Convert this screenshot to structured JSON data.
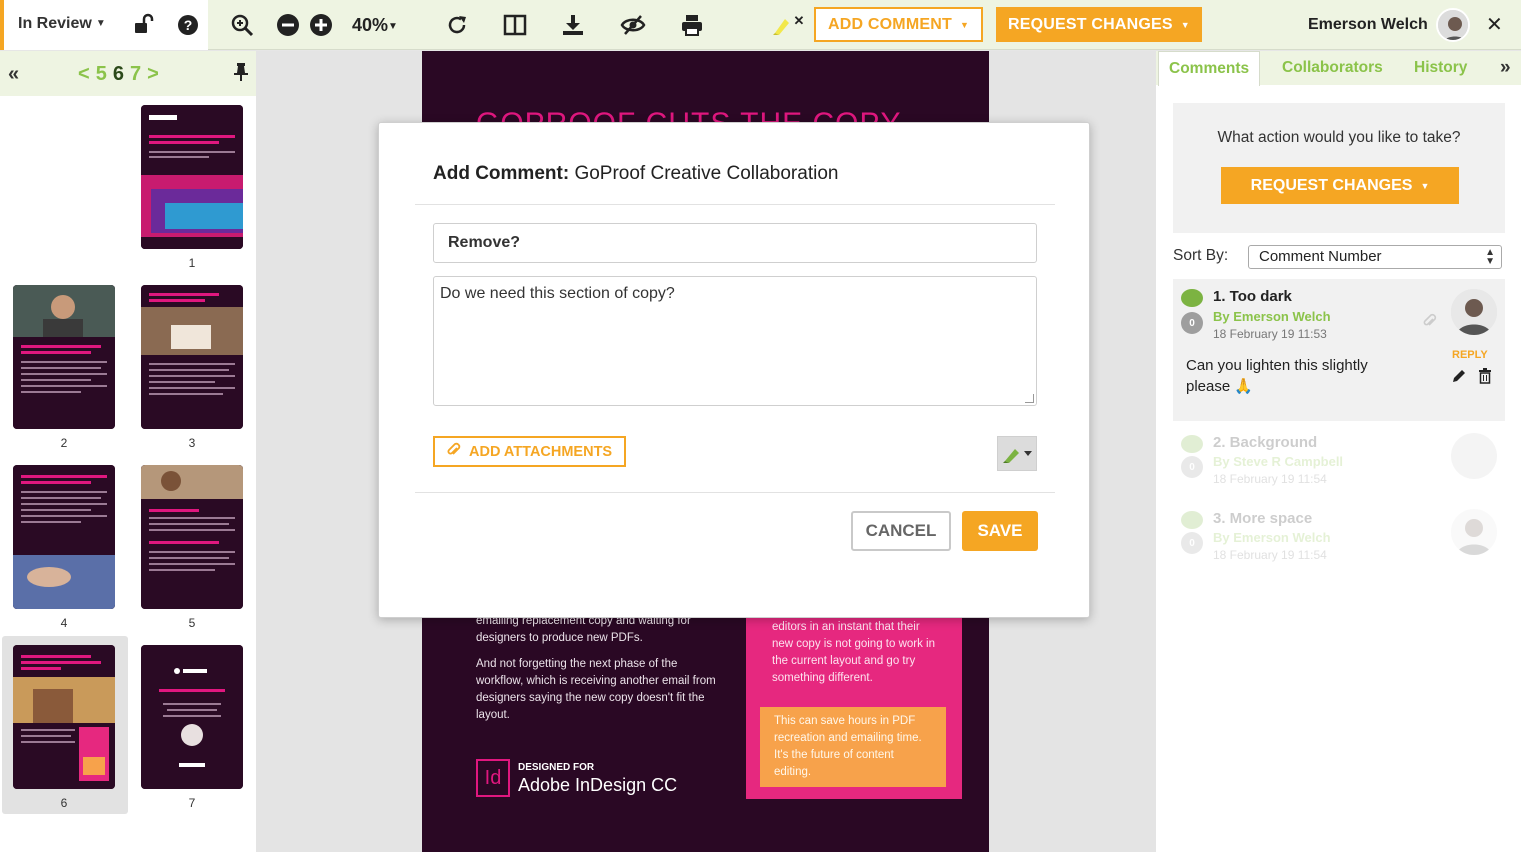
{
  "toolbar": {
    "status": "In Review",
    "zoom": "40%",
    "add_comment": "ADD COMMENT",
    "request_changes": "REQUEST CHANGES",
    "user_name": "Emerson Welch"
  },
  "left_panel": {
    "pages_prev": "<",
    "pages_nums": [
      "5",
      "6",
      "7"
    ],
    "pages_next": ">",
    "thumbnails": [
      "1",
      "2",
      "3",
      "4",
      "5",
      "6",
      "7"
    ]
  },
  "document": {
    "heading": "GOPROOF CUTS THE COPY",
    "para1": "emailing replacement copy and waiting for designers to produce new PDFs.",
    "para2": "And not forgetting the next phase of the workflow, which is receiving another email from designers saying the new copy doesn't fit the layout.",
    "pink_text": "editors in an instant that their new copy is not going to work in the current layout and go try something different.",
    "orange_text": "This can save hours in PDF recreation and emailing time. It's the future of content editing.",
    "logo_letters": "Id",
    "designed_for": "DESIGNED FOR",
    "product": "Adobe InDesign CC"
  },
  "modal": {
    "title_bold": "Add Comment:",
    "title_rest": "GoProof Creative Collaboration",
    "subject_value": "Remove?",
    "body_value": "Do we need this section of copy?",
    "attach_label": "ADD ATTACHMENTS",
    "cancel_label": "CANCEL",
    "save_label": "SAVE"
  },
  "right_panel": {
    "tabs": [
      "Comments",
      "Collaborators",
      "History"
    ],
    "action_question": "What action would you like to take?",
    "action_button": "REQUEST CHANGES",
    "sort_label": "Sort By:",
    "sort_value": "Comment Number",
    "comments": [
      {
        "title": "1. Too dark",
        "author": "By Emerson Welch",
        "date": "18 February 19 11:53",
        "text": "Can you lighten this slightly please 🙏",
        "reply": "REPLY",
        "badge": "0"
      },
      {
        "title": "2. Background",
        "author": "By Steve R Campbell",
        "date": "18 February 19 11:54",
        "badge": "0"
      },
      {
        "title": "3. More space",
        "author": "By Emerson Welch",
        "date": "18 February 19 11:54",
        "badge": "0"
      }
    ]
  },
  "colors": {
    "accent_orange": "#f5a623",
    "accent_green": "#8bc34a",
    "toolbar_bg": "#eef4e2",
    "doc_bg": "#2a0824",
    "doc_pink": "#e6287f"
  }
}
